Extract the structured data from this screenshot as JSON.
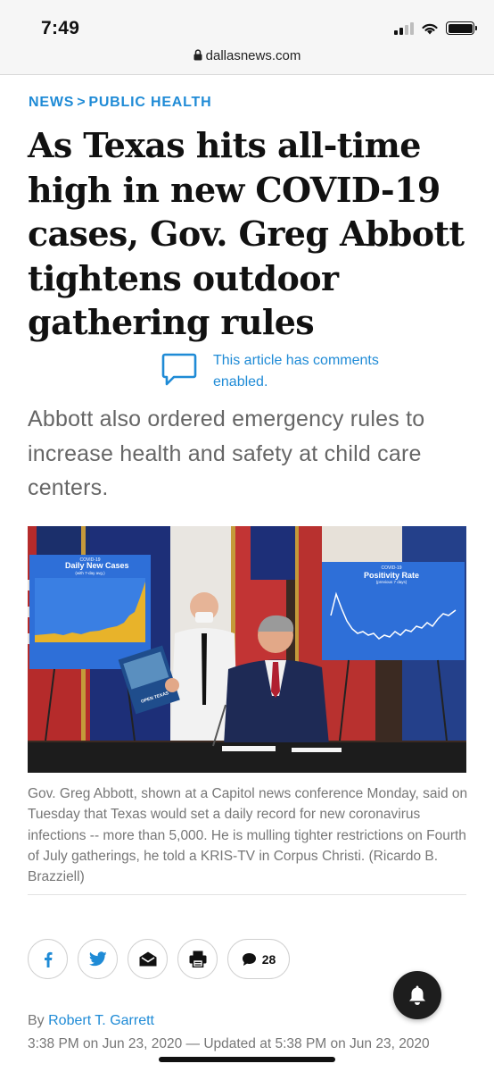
{
  "status_bar": {
    "time": "7:49"
  },
  "browser": {
    "url": "dallasnews.com"
  },
  "breadcrumb": {
    "section": "NEWS",
    "separator": ">",
    "subsection": "PUBLIC HEALTH"
  },
  "article": {
    "headline": "As Texas hits all-time high in new COVID-19 cases, Gov. Greg Abbott tightens outdoor gathering rules",
    "comments_note": "This article has comments enabled.",
    "dek": "Abbott also ordered emergency rules to increase health and safety at child care centers.",
    "photo": {
      "left_chart": {
        "top_label": "COVID-19",
        "title": "Daily New Cases",
        "subtitle": "(with 7-day avg.)"
      },
      "right_chart": {
        "top_label": "COVID-19",
        "title": "Positivity Rate",
        "subtitle": "(previous 7 days)"
      },
      "booklet_label": "OPEN TEXAS"
    },
    "caption": "Gov. Greg Abbott, shown at a Capitol news conference Monday, said on Tuesday that Texas would set a daily record for new coronavirus infections -- more than 5,000. He is mulling tighter restrictions on Fourth of July gatherings, he told a KRIS-TV in Corpus Christi.",
    "credit": "(Ricardo B. Brazziell)",
    "by_prefix": "By",
    "author": "Robert T. Garrett",
    "timestamp": "3:38 PM on Jun 23, 2020 — Updated at 5:38 PM on Jun 23, 2020"
  },
  "share": {
    "comment_count": "28"
  },
  "icons": {
    "facebook": "facebook-icon",
    "twitter": "twitter-icon",
    "email": "email-icon",
    "print": "print-icon",
    "comments": "comment-bubble-icon",
    "notifications": "bell-icon"
  },
  "colors": {
    "accent_blue": "#1f8bd6",
    "text_gray": "#666666",
    "chart_blue": "#2e6fd8",
    "chart_gold": "#e8b32a"
  }
}
